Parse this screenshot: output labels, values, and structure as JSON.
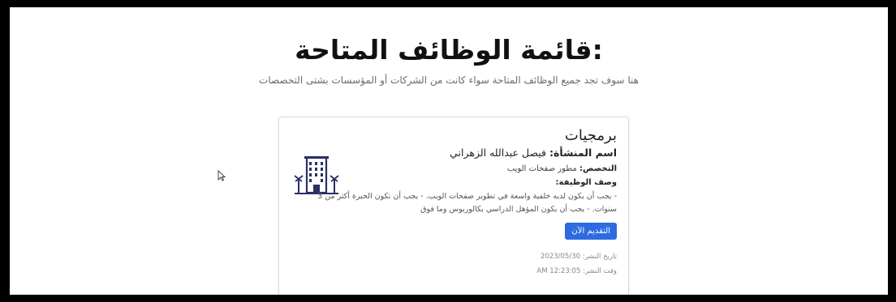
{
  "page": {
    "title": "قائمة الوظائف المتاحة:",
    "subtitle": "هنا سوف تجد جميع الوظائف المتاحة سواء كانت من الشركات أو المؤسسات بشتى التخصصات"
  },
  "job": {
    "category": "برمجيات",
    "org_label": "اسم المنشأة:",
    "org_name": "فيصل عبدالله الزهراني",
    "spec_label": "التخصص:",
    "spec_value": "مطور صفحات الويب",
    "desc_label": "وصف الوظيفة:",
    "desc_text": "- يجب أن يكون لديه خلفية واسعة في تطوير صفحات الويب. - يجب أن تكون الخبرة أكثر من 3 سنوات. - يجب أن يكون المؤهل الدراسي بكالوريوس وما فوق",
    "apply_label": "التقديم الآن",
    "date_label": "تاريخ النشر:",
    "date_value": "2023/05/30",
    "time_label": "وقت النشر:",
    "time_value": "12:23:05 AM",
    "icon": "building-icon"
  },
  "colors": {
    "accent": "#2d6be0",
    "icon": "#2b2f66"
  }
}
